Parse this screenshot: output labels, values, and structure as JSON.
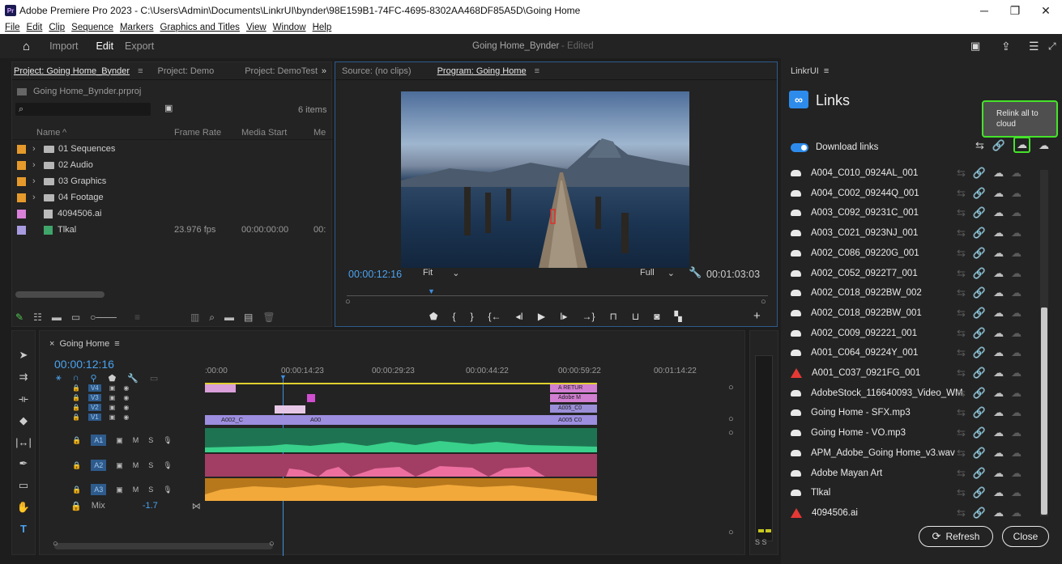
{
  "window": {
    "title": "Adobe Premiere Pro 2023 - C:\\Users\\Admin\\Documents\\LinkrUI\\bynder\\98E159B1-74FC-4695-8302AA468DF85A5D\\Going Home",
    "logo": "Pr"
  },
  "menu": [
    "File",
    "Edit",
    "Clip",
    "Sequence",
    "Markers",
    "Graphics and Titles",
    "View",
    "Window",
    "Help"
  ],
  "appbar": {
    "workspaces": [
      "Import",
      "Edit",
      "Export"
    ],
    "active": "Edit",
    "project_name": "Going Home_Bynder",
    "edited": "- Edited"
  },
  "project_panel": {
    "tabs": [
      "Project: Going Home_Bynder",
      "Project: Demo",
      "Project: DemoTest"
    ],
    "file": "Going Home_Bynder.prproj",
    "items_count": "6 items",
    "columns": [
      "Name",
      "Frame Rate",
      "Media Start",
      "Me"
    ],
    "rows": [
      {
        "name": "01 Sequences",
        "color": "#e59a2b",
        "type": "folder",
        "fps": "",
        "start": ""
      },
      {
        "name": "02 Audio",
        "color": "#e59a2b",
        "type": "folder",
        "fps": "",
        "start": ""
      },
      {
        "name": "03 Graphics",
        "color": "#e59a2b",
        "type": "folder",
        "fps": "",
        "start": ""
      },
      {
        "name": "04 Footage",
        "color": "#e59a2b",
        "type": "folder",
        "fps": "",
        "start": ""
      },
      {
        "name": "4094506.ai",
        "color": "#d980d9",
        "type": "file",
        "fps": "",
        "start": ""
      },
      {
        "name": "Tlkal",
        "color": "#a89be0",
        "type": "sequence",
        "fps": "23.976 fps",
        "start": "00:00:00:00",
        "extra": "00:"
      }
    ]
  },
  "monitor": {
    "source_tab": "Source: (no clips)",
    "program_tab": "Program: Going Home",
    "timecode": "00:00:12:16",
    "fit": "Fit",
    "quality": "Full",
    "duration": "00:01:03:03"
  },
  "timeline": {
    "tab": "Going Home",
    "timecode": "00:00:12:16",
    "ruler": [
      ":00:00",
      "00:00:14:23",
      "00:00:29:23",
      "00:00:44:22",
      "00:00:59:22",
      "00:01:14:22"
    ],
    "video_tracks": [
      "V4",
      "V3",
      "V2",
      "V1"
    ],
    "audio_tracks": [
      "A1",
      "A2",
      "A3"
    ],
    "mix_label": "Mix",
    "mix_value": "-1.7",
    "clip_labels": {
      "a_retur": "A RETUR",
      "adobe_m": "Adobe M",
      "a005_c0": "A005_C0",
      "a005_c0b": "A005 C0",
      "a002_c": "A002_C",
      "a00": "A00"
    },
    "meter_labels": "S S"
  },
  "links_panel": {
    "tab": "LinkrUI",
    "title": "Links",
    "tooltip": "Relink all to cloud",
    "download_toggle": "Download links",
    "items": [
      {
        "name": "A004_C010_0924AL_001",
        "status": "cloud"
      },
      {
        "name": "A004_C002_09244Q_001",
        "status": "cloud"
      },
      {
        "name": "A003_C092_09231C_001",
        "status": "cloud"
      },
      {
        "name": "A003_C021_0923NJ_001",
        "status": "cloud"
      },
      {
        "name": "A002_C086_09220G_001",
        "status": "cloud"
      },
      {
        "name": "A002_C052_0922T7_001",
        "status": "cloud"
      },
      {
        "name": "A002_C018_0922BW_002",
        "status": "cloud"
      },
      {
        "name": "A002_C018_0922BW_001",
        "status": "cloud"
      },
      {
        "name": "A002_C009_092221_001",
        "status": "cloud"
      },
      {
        "name": "A001_C064_09224Y_001",
        "status": "cloud"
      },
      {
        "name": "A001_C037_0921FG_001",
        "status": "warning"
      },
      {
        "name": "AdobeStock_116640093_Video_WM",
        "status": "cloud"
      },
      {
        "name": "Going Home - SFX.mp3",
        "status": "cloud"
      },
      {
        "name": "Going Home - VO.mp3",
        "status": "cloud"
      },
      {
        "name": "APM_Adobe_Going Home_v3.wav",
        "status": "cloud"
      },
      {
        "name": "Adobe Mayan Art",
        "status": "cloud"
      },
      {
        "name": "Tlkal",
        "status": "cloud"
      },
      {
        "name": "4094506.ai",
        "status": "warning"
      }
    ],
    "refresh_label": "Refresh",
    "close_label": "Close"
  },
  "colors": {
    "accent": "#2d8ceb",
    "highlight": "#45e32b",
    "warning": "#e53935"
  }
}
